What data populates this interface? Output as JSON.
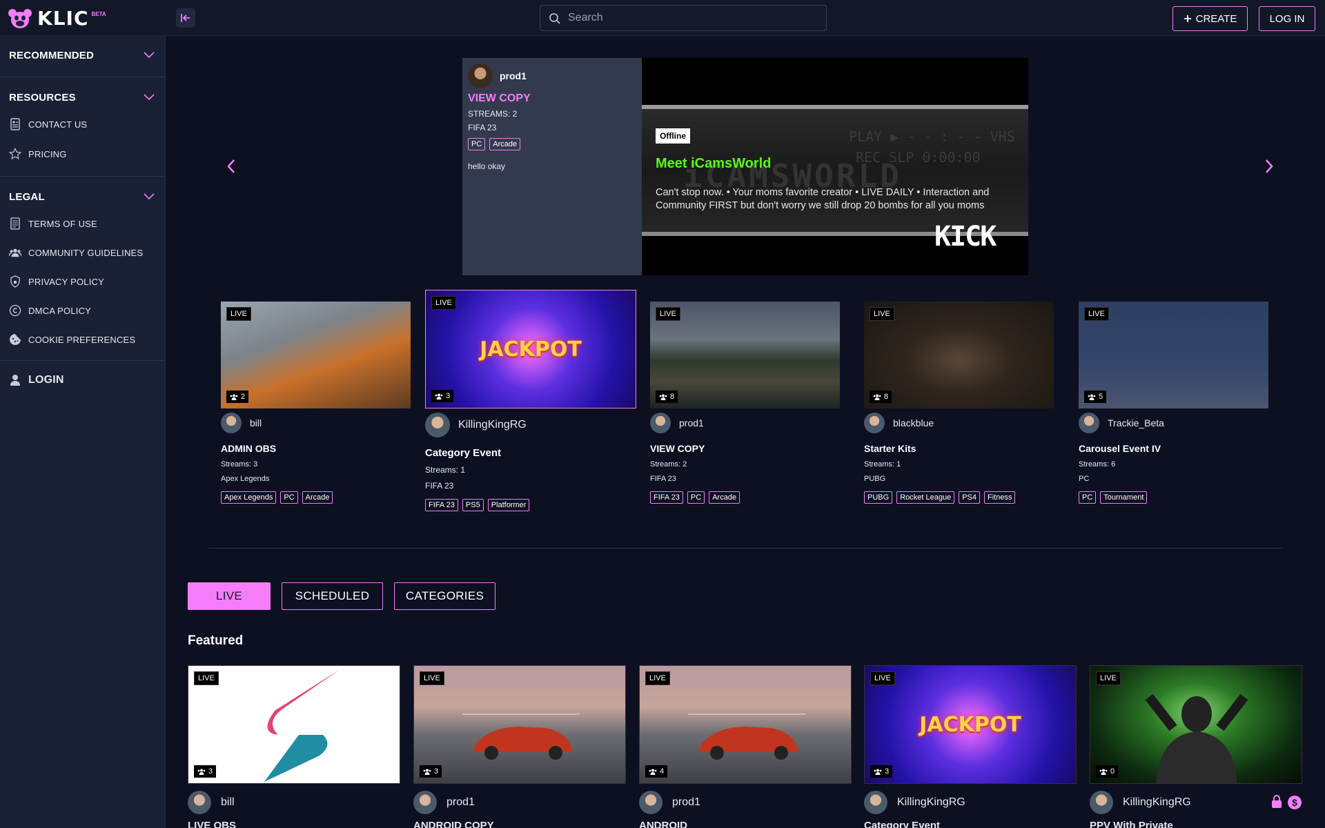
{
  "brand": {
    "name": "KLIC",
    "badge": "BETA"
  },
  "header": {
    "search_placeholder": "Search",
    "create_label": "CREATE",
    "login_label": "LOG IN"
  },
  "sidebar": {
    "recommended": "RECOMMENDED",
    "resources": "RESOURCES",
    "resources_items": [
      "CONTACT US",
      "PRICING"
    ],
    "legal": "LEGAL",
    "legal_items": [
      "TERMS OF USE",
      "COMMUNITY GUIDELINES",
      "PRIVACY POLICY",
      "DMCA POLICY",
      "COOKIE PREFERENCES"
    ],
    "login": "LOGIN"
  },
  "hero": {
    "user": "prod1",
    "title": "VIEW COPY",
    "streams": "STREAMS: 2",
    "game": "FIFA 23",
    "tags": [
      "PC",
      "Arcade"
    ],
    "description": "hello okay",
    "status": "Offline",
    "channel": "Meet iCamsWorld",
    "bio": "Can't stop now. • Your moms favorite creator • LIVE DAILY • Interaction and Community FIRST but don't worry we still drop 20 bombs for all you moms",
    "platform": "KICK",
    "vhs_text_1": "PLAY ▶ - - : - -     VHS",
    "vhs_text_2": "REC       SLP 0:00:00",
    "vhs_big": "iCAMSWORLD"
  },
  "carousel": [
    {
      "live": "LIVE",
      "viewers": "2",
      "user": "bill",
      "title": "ADMIN OBS",
      "streams": "Streams: 3",
      "game": "Apex Legends",
      "tags": [
        "Apex Legends",
        "PC",
        "Arcade"
      ],
      "theme": "battle"
    },
    {
      "live": "LIVE",
      "viewers": "3",
      "user": "KillingKingRG",
      "title": "Category Event",
      "streams": "Streams: 1",
      "game": "FIFA 23",
      "tags": [
        "FIFA 23",
        "PS5",
        "Platformer"
      ],
      "theme": "jackpot",
      "jackpot": "JACKPOT"
    },
    {
      "live": "LIVE",
      "viewers": "8",
      "user": "prod1",
      "title": "VIEW COPY",
      "streams": "Streams: 2",
      "game": "FIFA 23",
      "tags": [
        "FIFA 23",
        "PC",
        "Arcade"
      ],
      "theme": "lake"
    },
    {
      "live": "LIVE",
      "viewers": "8",
      "user": "blackblue",
      "title": "Starter Kits",
      "streams": "Streams: 1",
      "game": "PUBG",
      "tags": [
        "PUBG",
        "Rocket League",
        "PS4",
        "Fitness"
      ],
      "theme": "portrait"
    },
    {
      "live": "LIVE",
      "viewers": "5",
      "user": "Trackie_Beta",
      "title": "Carousel Event IV",
      "streams": "Streams: 6",
      "game": "PC",
      "tags": [
        "PC",
        "Tournament"
      ],
      "theme": "anime"
    }
  ],
  "tabs": [
    "LIVE",
    "SCHEDULED",
    "CATEGORIES"
  ],
  "featured": {
    "heading": "Featured",
    "cards": [
      {
        "live": "LIVE",
        "viewers": "3",
        "user": "bill",
        "title": "LIVE OBS",
        "theme": "logo"
      },
      {
        "live": "LIVE",
        "viewers": "3",
        "user": "prod1",
        "title": "ANDROID COPY",
        "theme": "car"
      },
      {
        "live": "LIVE",
        "viewers": "4",
        "user": "prod1",
        "title": "ANDROID",
        "theme": "car"
      },
      {
        "live": "LIVE",
        "viewers": "3",
        "user": "KillingKingRG",
        "title": "Category Event",
        "theme": "jackpot",
        "jackpot": "JACKPOT"
      },
      {
        "live": "LIVE",
        "viewers": "0",
        "user": "KillingKingRG",
        "title": "PPV With Private",
        "theme": "gamer"
      }
    ]
  },
  "colors": {
    "accent": "#f57dfa",
    "kick_green": "#53fc18",
    "bg": "#0d1021",
    "sidebar": "#1b2134"
  }
}
